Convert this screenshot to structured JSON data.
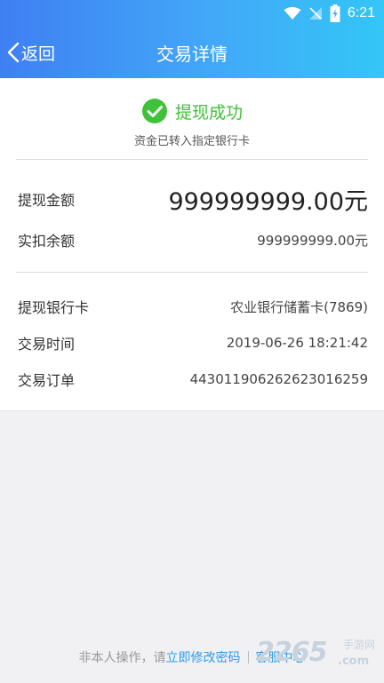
{
  "status_bar": {
    "time": "6:21"
  },
  "nav": {
    "back_label": "返回",
    "title": "交易详情"
  },
  "result": {
    "title": "提现成功",
    "subtitle": "资金已转入指定银行卡"
  },
  "amounts": {
    "withdraw_label": "提现金额",
    "withdraw_value": "999999999.00元",
    "deduct_label": "实扣余额",
    "deduct_value": "999999999.00元"
  },
  "details": [
    {
      "label": "提现银行卡",
      "value": "农业银行储蓄卡(7869)"
    },
    {
      "label": "交易时间",
      "value": "2019-06-26 18:21:42"
    },
    {
      "label": "交易订单",
      "value": "443011906262623016259"
    }
  ],
  "footer": {
    "prefix": "非本人操作，请",
    "change_password": "立即修改密码",
    "service": "客服中心"
  },
  "watermark": {
    "digits": "2265",
    "cn": "手游网",
    "url": ".com"
  },
  "colors": {
    "success": "#3fc23a",
    "link": "#2a9bea",
    "header_start": "#3f7ff3",
    "header_end": "#33c6f6"
  }
}
